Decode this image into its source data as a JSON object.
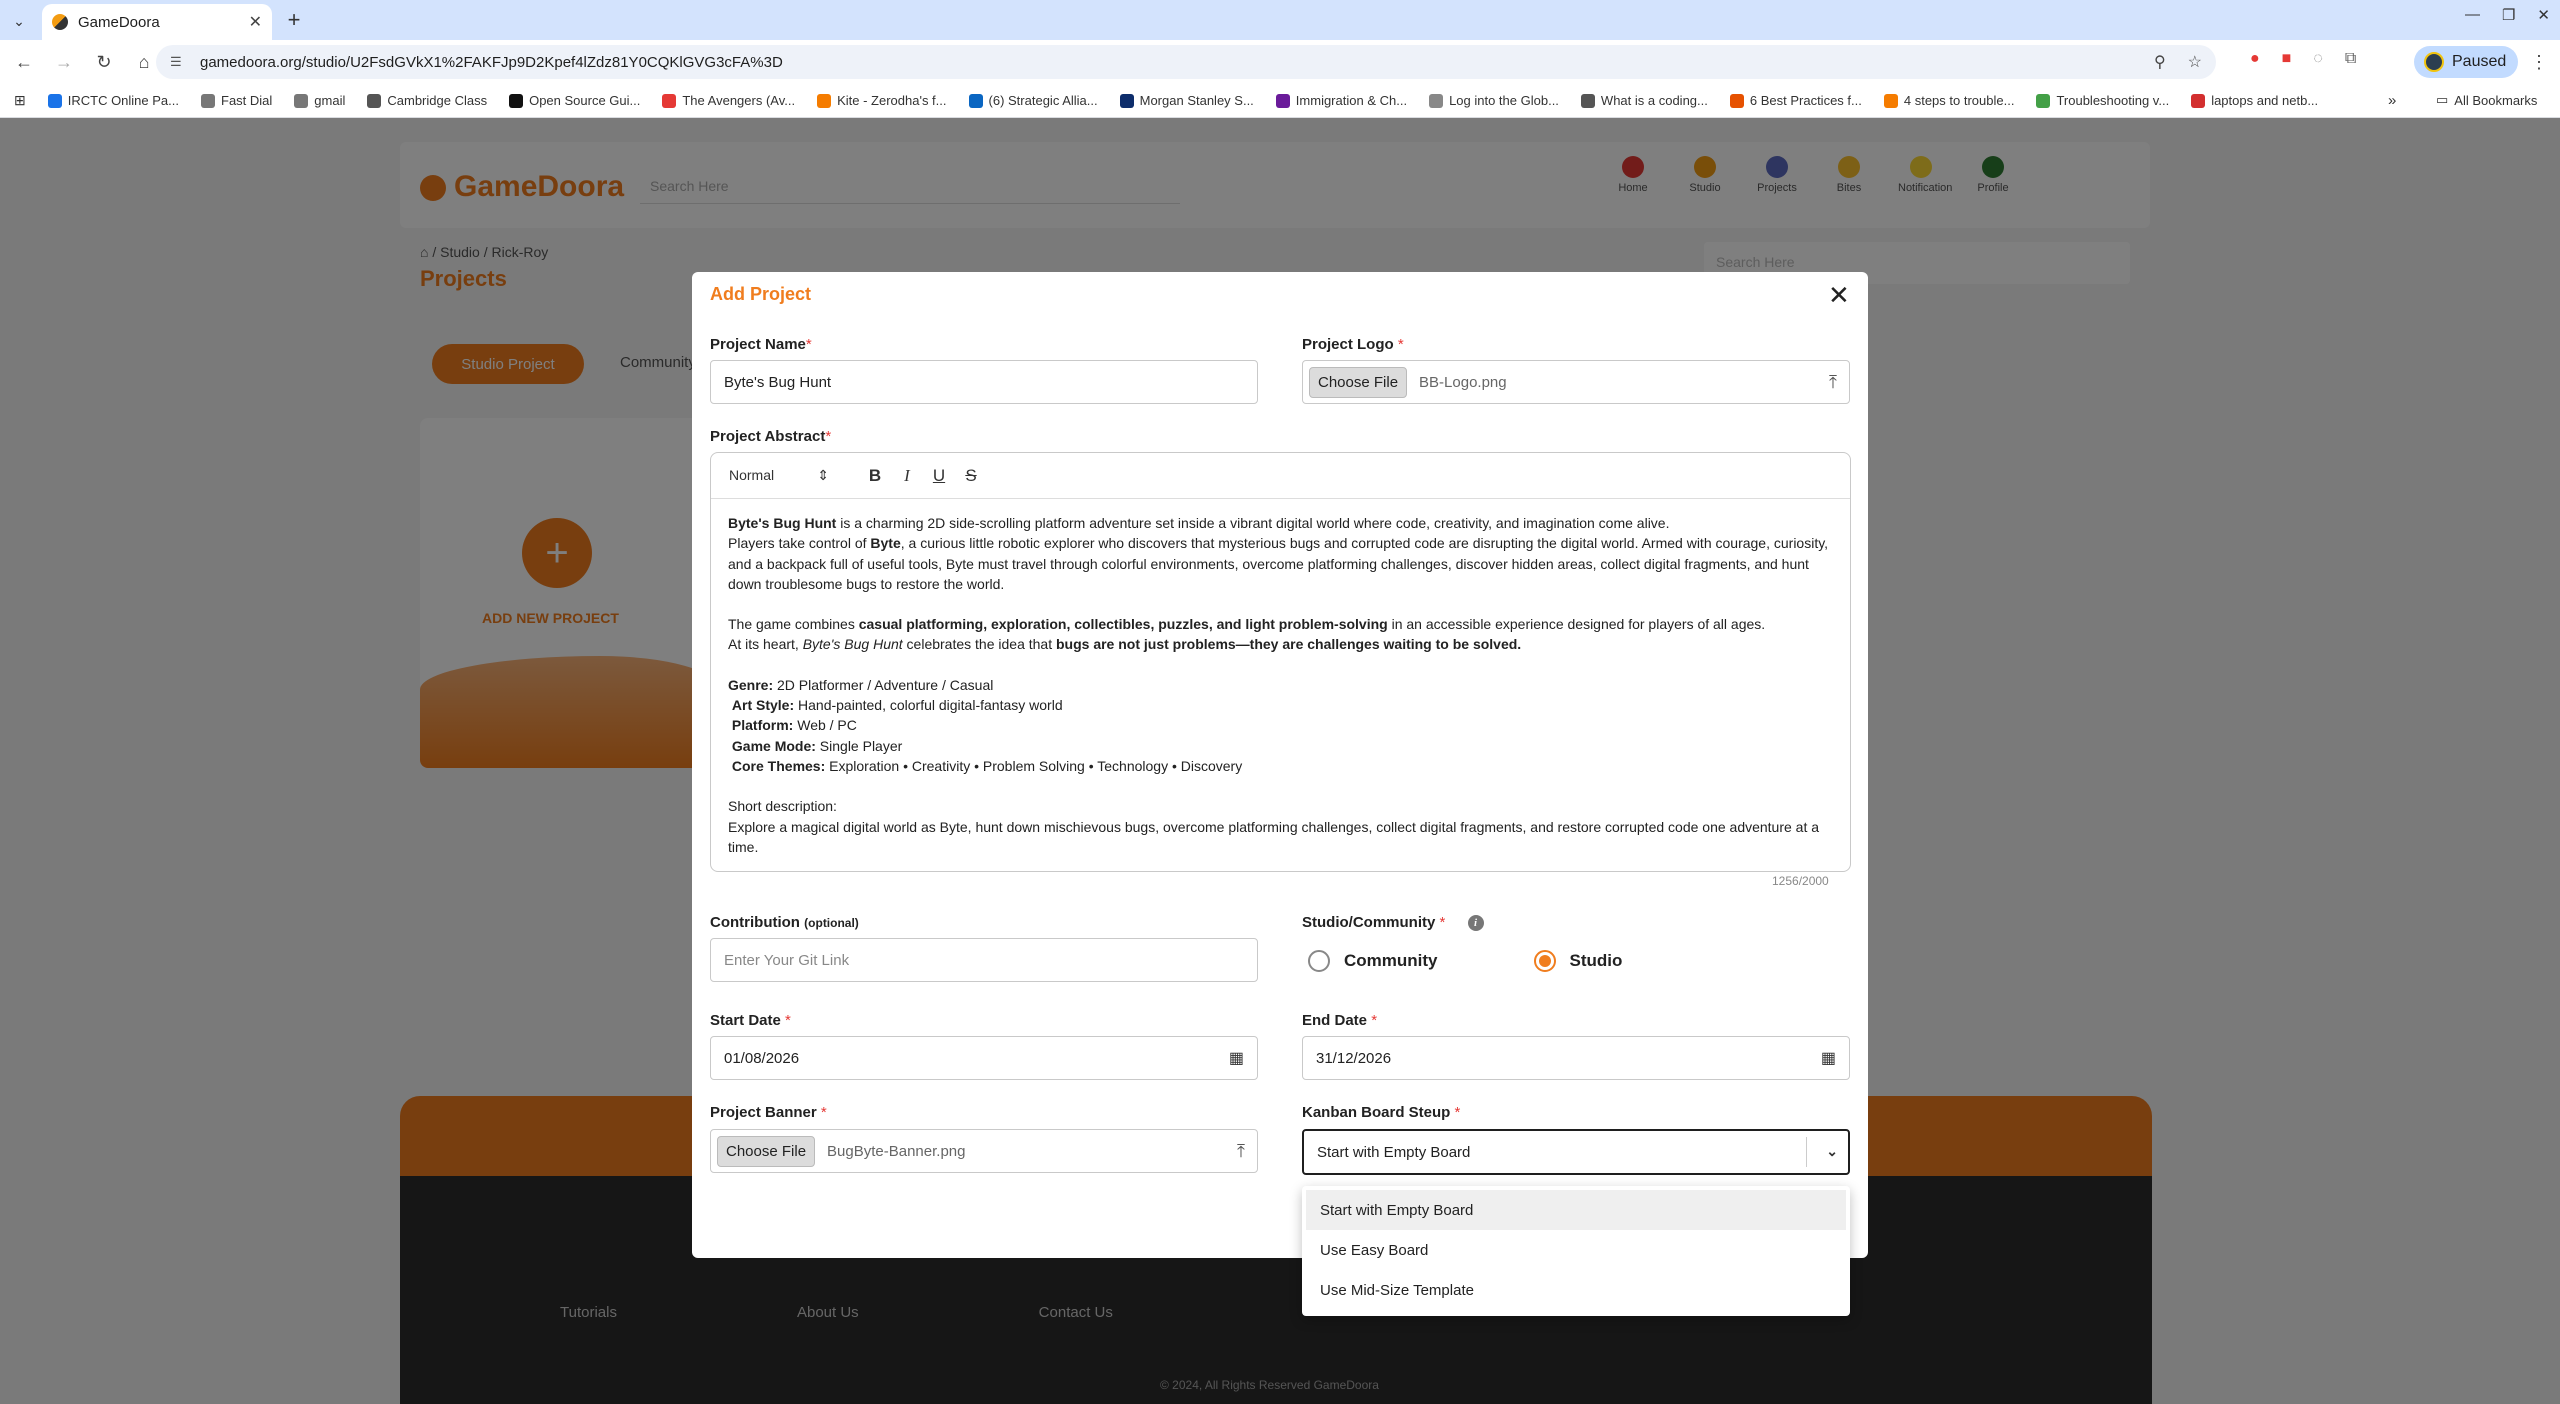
{
  "browser": {
    "tab_title": "GameDoora",
    "url": "gamedoora.org/studio/U2FsdGVkX1%2FAKFJp9D2Kpef4lZdz81Y0CQKlGVG3cFA%3D",
    "profile_label": "Paused",
    "bookmarks": [
      {
        "label": "IRCTC Online Pa...",
        "color": "#1a73e8"
      },
      {
        "label": "Fast Dial",
        "color": "#777"
      },
      {
        "label": "gmail",
        "color": "#777"
      },
      {
        "label": "Cambridge Class",
        "color": "#555"
      },
      {
        "label": "Open Source Gui...",
        "color": "#111"
      },
      {
        "label": "The Avengers (Av...",
        "color": "#e53935"
      },
      {
        "label": "Kite - Zerodha's f...",
        "color": "#f57c00"
      },
      {
        "label": "(6) Strategic Allia...",
        "color": "#0a66c2"
      },
      {
        "label": "Morgan Stanley S...",
        "color": "#0d2d6b"
      },
      {
        "label": "Immigration & Ch...",
        "color": "#6a1b9a"
      },
      {
        "label": "Log into the Glob...",
        "color": "#888"
      },
      {
        "label": "What is a coding...",
        "color": "#555"
      },
      {
        "label": "6 Best Practices f...",
        "color": "#e65100"
      },
      {
        "label": "4 steps to trouble...",
        "color": "#f57c00"
      },
      {
        "label": "Troubleshooting v...",
        "color": "#43a047"
      },
      {
        "label": "laptops and netb...",
        "color": "#d32f2f"
      }
    ],
    "all_bookmarks": "All Bookmarks"
  },
  "modal": {
    "title": "Add Project",
    "project_name": {
      "label": "Project Name",
      "value": "Byte's Bug Hunt"
    },
    "project_logo": {
      "label": "Project Logo",
      "button": "Choose File",
      "file": "BB-Logo.png"
    },
    "abstract": {
      "label": "Project Abstract",
      "toolbar_style": "Normal",
      "counter": "1256/2000",
      "p1_bold": "Byte's Bug Hunt",
      "p1_rest": " is a charming 2D side-scrolling platform adventure set inside a vibrant digital world where code, creativity, and imagination come alive.",
      "p2_a": "Players take control of ",
      "p2_bold": "Byte",
      "p2_rest": ", a curious little robotic explorer who discovers that mysterious bugs and corrupted code are disrupting the digital world. Armed with courage, curiosity, and a backpack full of useful tools, Byte must travel through colorful environments, overcome platforming challenges, discover hidden areas, collect digital fragments, and hunt down troublesome bugs to restore the world.",
      "p3_a": "The game combines ",
      "p3_bold": "casual platforming, exploration, collectibles, puzzles, and light problem-solving",
      "p3_rest": " in an accessible experience designed for players of all ages.",
      "p4_a": "At its heart, ",
      "p4_italic": "Byte's Bug Hunt",
      "p4_b": " celebrates the idea that ",
      "p4_bold": "bugs are not just problems—they are challenges waiting to be solved.",
      "genre_k": "Genre:",
      "genre_v": " 2D Platformer / Adventure / Casual",
      "art_k": "Art Style:",
      "art_v": " Hand-painted, colorful digital-fantasy world",
      "platform_k": "Platform:",
      "platform_v": " Web / PC",
      "mode_k": "Game Mode:",
      "mode_v": " Single Player",
      "themes_k": "Core Themes:",
      "themes_v": " Exploration • Creativity • Problem Solving • Technology • Discovery",
      "short_label": "Short description:",
      "short_text": "Explore a magical digital world as Byte, hunt down mischievous bugs, overcome platforming challenges, collect digital fragments, and restore corrupted code one adventure at a time."
    },
    "contribution": {
      "label": "Contribution",
      "optional": "(optional)",
      "placeholder": "Enter Your Git Link"
    },
    "studio_community": {
      "label": "Studio/Community",
      "options": [
        "Community",
        "Studio"
      ],
      "selected": "Studio"
    },
    "start_date": {
      "label": "Start Date",
      "value": "01/08/2026"
    },
    "end_date": {
      "label": "End Date",
      "value": "31/12/2026"
    },
    "banner": {
      "label": "Project Banner",
      "button": "Choose File",
      "file": "BugByte-Banner.png"
    },
    "kanban": {
      "label": "Kanban Board Steup",
      "value": "Start with Empty Board",
      "options": [
        "Start with Empty Board",
        "Use Easy Board",
        "Use Mid-Size Template"
      ]
    }
  },
  "colors": {
    "accent": "#f07d1e",
    "required": "#e53935"
  }
}
